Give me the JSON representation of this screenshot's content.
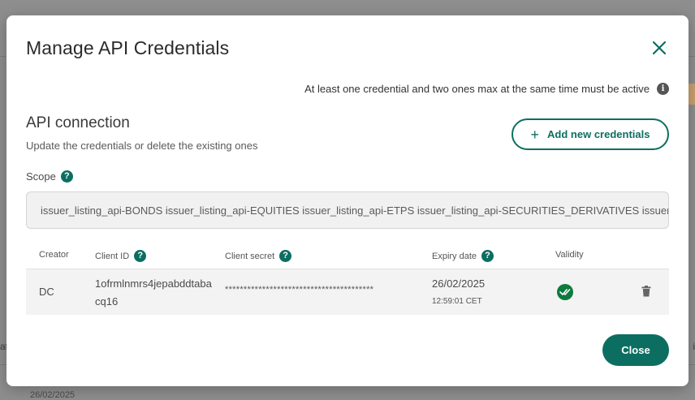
{
  "background": {
    "date": "26/02/2025",
    "left_edge_text": "at",
    "right_edge_text": "i"
  },
  "modal": {
    "title": "Manage API Credentials",
    "notice": "At least one credential and two ones max at the same time must be active",
    "section_title": "API connection",
    "section_subtitle": "Update the credentials or delete the existing ones",
    "add_button_label": "Add new credentials",
    "scope_label": "Scope",
    "scope_value": "issuer_listing_api-BONDS issuer_listing_api-EQUITIES issuer_listing_api-ETPS issuer_listing_api-SECURITIES_DERIVATIVES issuer_listing_api-WARRANTS",
    "close_button_label": "Close"
  },
  "table": {
    "headers": {
      "creator": "Creator",
      "client_id": "Client ID",
      "client_secret": "Client secret",
      "expiry_date": "Expiry date",
      "validity": "Validity"
    },
    "rows": [
      {
        "creator": "DC",
        "client_id": "1ofrmlnmrs4jepabddtabacq16",
        "client_secret": "****************************************",
        "expiry_date": "26/02/2025",
        "expiry_time": "12:59:01 CET",
        "valid": true
      }
    ]
  },
  "colors": {
    "accent": "#0c6e61",
    "valid": "#0d7a3e"
  },
  "icons": {
    "close": "close-icon",
    "info": "info-icon",
    "help": "help-icon",
    "plus": "plus-icon",
    "valid": "double-check-icon",
    "delete": "trash-icon"
  }
}
